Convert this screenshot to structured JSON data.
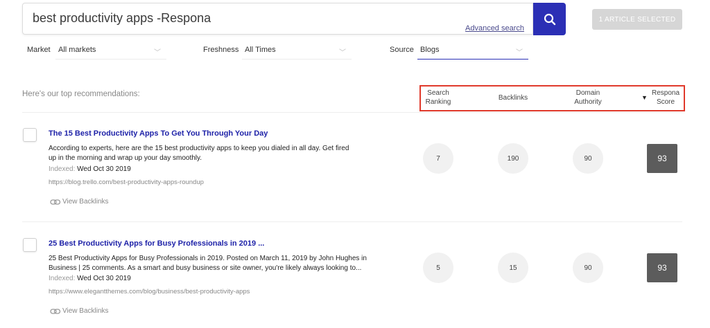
{
  "search": {
    "query": "best productivity apps -Respona",
    "advanced_link": "Advanced search"
  },
  "selected_button": "1 ARTICLE SELECTED",
  "filters": {
    "market": {
      "label": "Market",
      "value": "All markets"
    },
    "freshness": {
      "label": "Freshness",
      "value": "All Times"
    },
    "source": {
      "label": "Source",
      "value": "Blogs"
    }
  },
  "recommendations_label": "Here's our top recommendations:",
  "columns": {
    "search_ranking": [
      "Search",
      "Ranking"
    ],
    "backlinks": "Backlinks",
    "domain_authority": [
      "Domain",
      "Authority"
    ],
    "respona_score": [
      "Respona",
      "Score"
    ],
    "sort_indicator": "▼"
  },
  "articles": [
    {
      "title": "The 15 Best Productivity Apps To Get You Through Your Day",
      "desc1": "According to experts, here are the 15 best productivity apps to keep you dialed in all day. Get fired",
      "desc2": "up in the morning and wrap up your day smoothly.",
      "indexed_label": "Indexed:",
      "indexed_date": "Wed Oct 30 2019",
      "url": "https://blog.trello.com/best-productivity-apps-roundup",
      "view_backlinks": "View Backlinks",
      "search_ranking": "7",
      "backlinks": "190",
      "domain_authority": "90",
      "respona_score": "93"
    },
    {
      "title": "25 Best Productivity Apps for Busy Professionals in 2019 ...",
      "desc1": "25 Best Productivity Apps for Busy Professionals in 2019. Posted on March 11, 2019 by John Hughes in",
      "desc2": "Business | 25 comments. As a smart and busy business or site owner, you're likely always looking to...",
      "indexed_label": "Indexed:",
      "indexed_date": "Wed Oct 30 2019",
      "url": "https://www.elegantthemes.com/blog/business/best-productivity-apps",
      "view_backlinks": "View Backlinks",
      "search_ranking": "5",
      "backlinks": "15",
      "domain_authority": "90",
      "respona_score": "93"
    }
  ]
}
